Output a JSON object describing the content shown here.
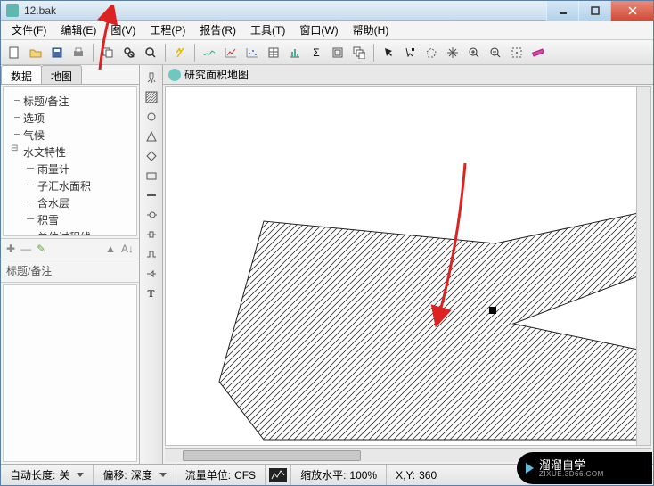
{
  "title": "12.bak",
  "menu": {
    "file": "文件(F)",
    "edit": "编辑(E)",
    "view": "图(V)",
    "project": "工程(P)",
    "report": "报告(R)",
    "tool": "工具(T)",
    "window": "窗口(W)",
    "help": "帮助(H)"
  },
  "sidebar": {
    "tabs": {
      "data": "数据",
      "map": "地图"
    },
    "tree": {
      "title_notes": "标题/备注",
      "options": "选项",
      "climate": "气候",
      "hydro": "水文特性",
      "rain_gauge": "雨量计",
      "sub_area": "子汇水面积",
      "aquifer": "含水层",
      "snow": "积雪",
      "unit_hydro": "单位过程线"
    },
    "prop_title": "标题/备注"
  },
  "canvas_tab": "研究面积地图",
  "status": {
    "auto_len_label": "自动长度:",
    "auto_len_value": "关",
    "offset_label": "偏移:",
    "offset_value": "深度",
    "flow_unit_label": "流量单位:",
    "flow_unit_value": "CFS",
    "zoom_label": "缩放水平:",
    "zoom_value": "100%",
    "xy_label": "X,Y:",
    "xy_value": "360"
  },
  "watermark": {
    "cn": "溜溜自学",
    "en": "ZIXUE.3D66.COM"
  }
}
